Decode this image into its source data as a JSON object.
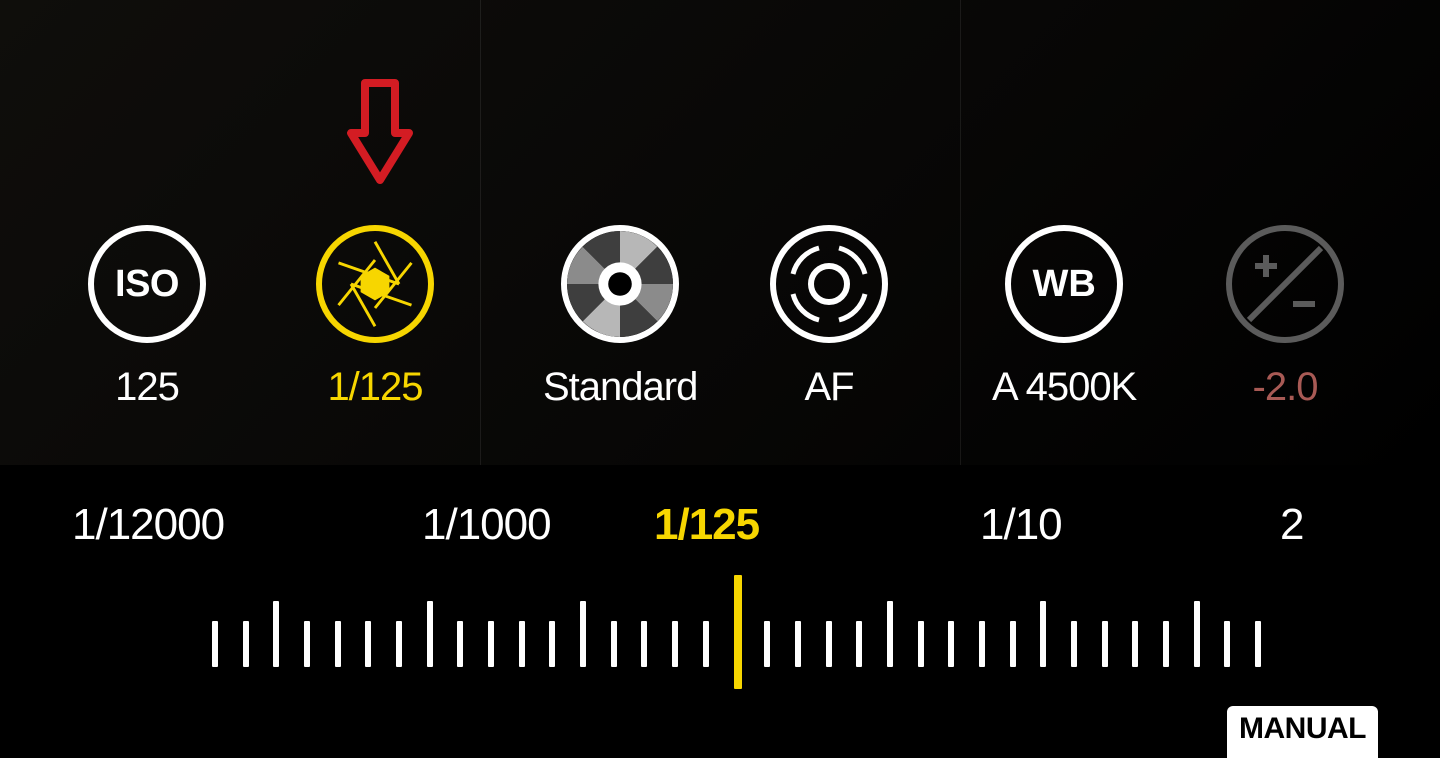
{
  "controls": {
    "iso": {
      "value": "125",
      "icon_text": "ISO"
    },
    "shutter": {
      "value": "1/125"
    },
    "tone": {
      "value": "Standard"
    },
    "focus": {
      "value": "AF"
    },
    "wb": {
      "value": "A 4500K",
      "icon_text": "WB"
    },
    "ev": {
      "value": "-2.0"
    }
  },
  "scale": {
    "labels": [
      "1/12000",
      "1/1000",
      "1/125",
      "1/10",
      "2"
    ],
    "selected": "1/125"
  },
  "mode_tag": "MANUAL",
  "accent_color": "#f7d600",
  "warn_color": "#a85a55"
}
